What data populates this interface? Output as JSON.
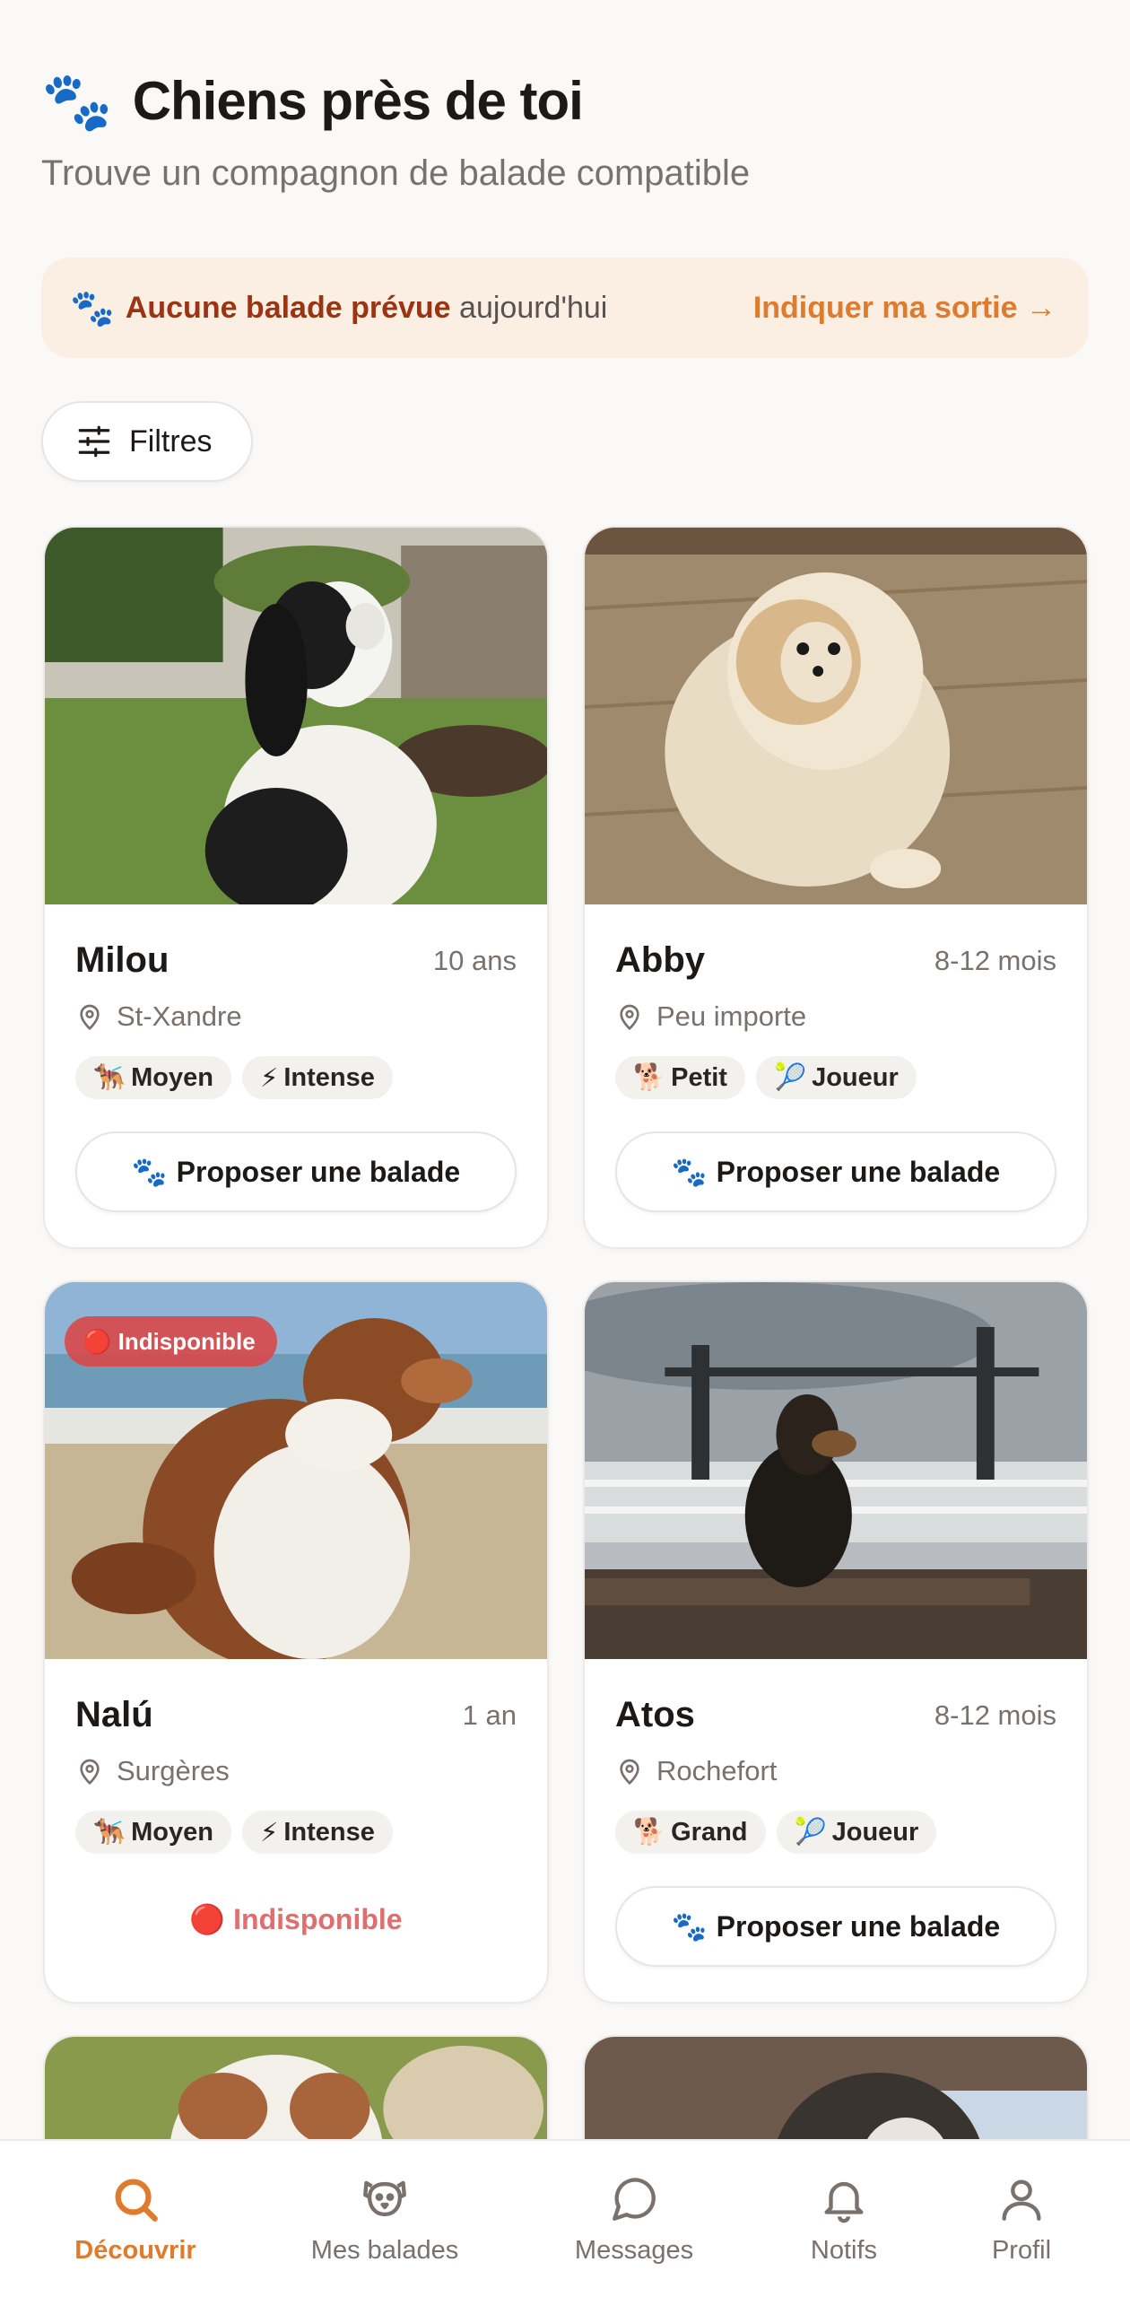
{
  "header": {
    "title": "Chiens près de toi",
    "subtitle": "Trouve un compagnon de balade compatible"
  },
  "banner": {
    "bold_text": "Aucune balade prévue",
    "rest_text": " aujourd'hui",
    "link_label": "Indiquer ma sortie →"
  },
  "filters": {
    "label": "Filtres"
  },
  "dogs": [
    {
      "name": "Milou",
      "age": "10 ans",
      "location": "St-Xandre",
      "tags": [
        {
          "icon": "🐕‍🦺",
          "label": "Moyen"
        },
        {
          "icon": "⚡",
          "label": "Intense"
        }
      ],
      "action_label": "Proposer une balade",
      "available": true
    },
    {
      "name": "Abby",
      "age": "8-12 mois",
      "location": "Peu importe",
      "tags": [
        {
          "icon": "🐕",
          "label": "Petit"
        },
        {
          "icon": "🎾",
          "label": "Joueur"
        }
      ],
      "action_label": "Proposer une balade",
      "available": true
    },
    {
      "name": "Nalú",
      "age": "1 an",
      "location": "Surgères",
      "tags": [
        {
          "icon": "🐕‍🦺",
          "label": "Moyen"
        },
        {
          "icon": "⚡",
          "label": "Intense"
        }
      ],
      "badge": "🔴 Indisponible",
      "unavailable_label": "🔴 Indisponible",
      "available": false
    },
    {
      "name": "Atos",
      "age": "8-12 mois",
      "location": "Rochefort",
      "tags": [
        {
          "icon": "🐕",
          "label": "Grand"
        },
        {
          "icon": "🎾",
          "label": "Joueur"
        }
      ],
      "action_label": "Proposer une balade",
      "available": true
    }
  ],
  "nav": [
    {
      "label": "Découvrir",
      "icon": "search-icon",
      "active": true
    },
    {
      "label": "Mes balades",
      "icon": "dog-face-icon",
      "active": false
    },
    {
      "label": "Messages",
      "icon": "chat-bubble-icon",
      "active": false
    },
    {
      "label": "Notifs",
      "icon": "bell-icon",
      "active": false
    },
    {
      "label": "Profil",
      "icon": "user-icon",
      "active": false
    }
  ],
  "colors": {
    "accent": "#e07a2c",
    "banner_bg": "#fbefe4",
    "banner_bold": "#9a3412",
    "unavailable": "#e16e6e"
  }
}
